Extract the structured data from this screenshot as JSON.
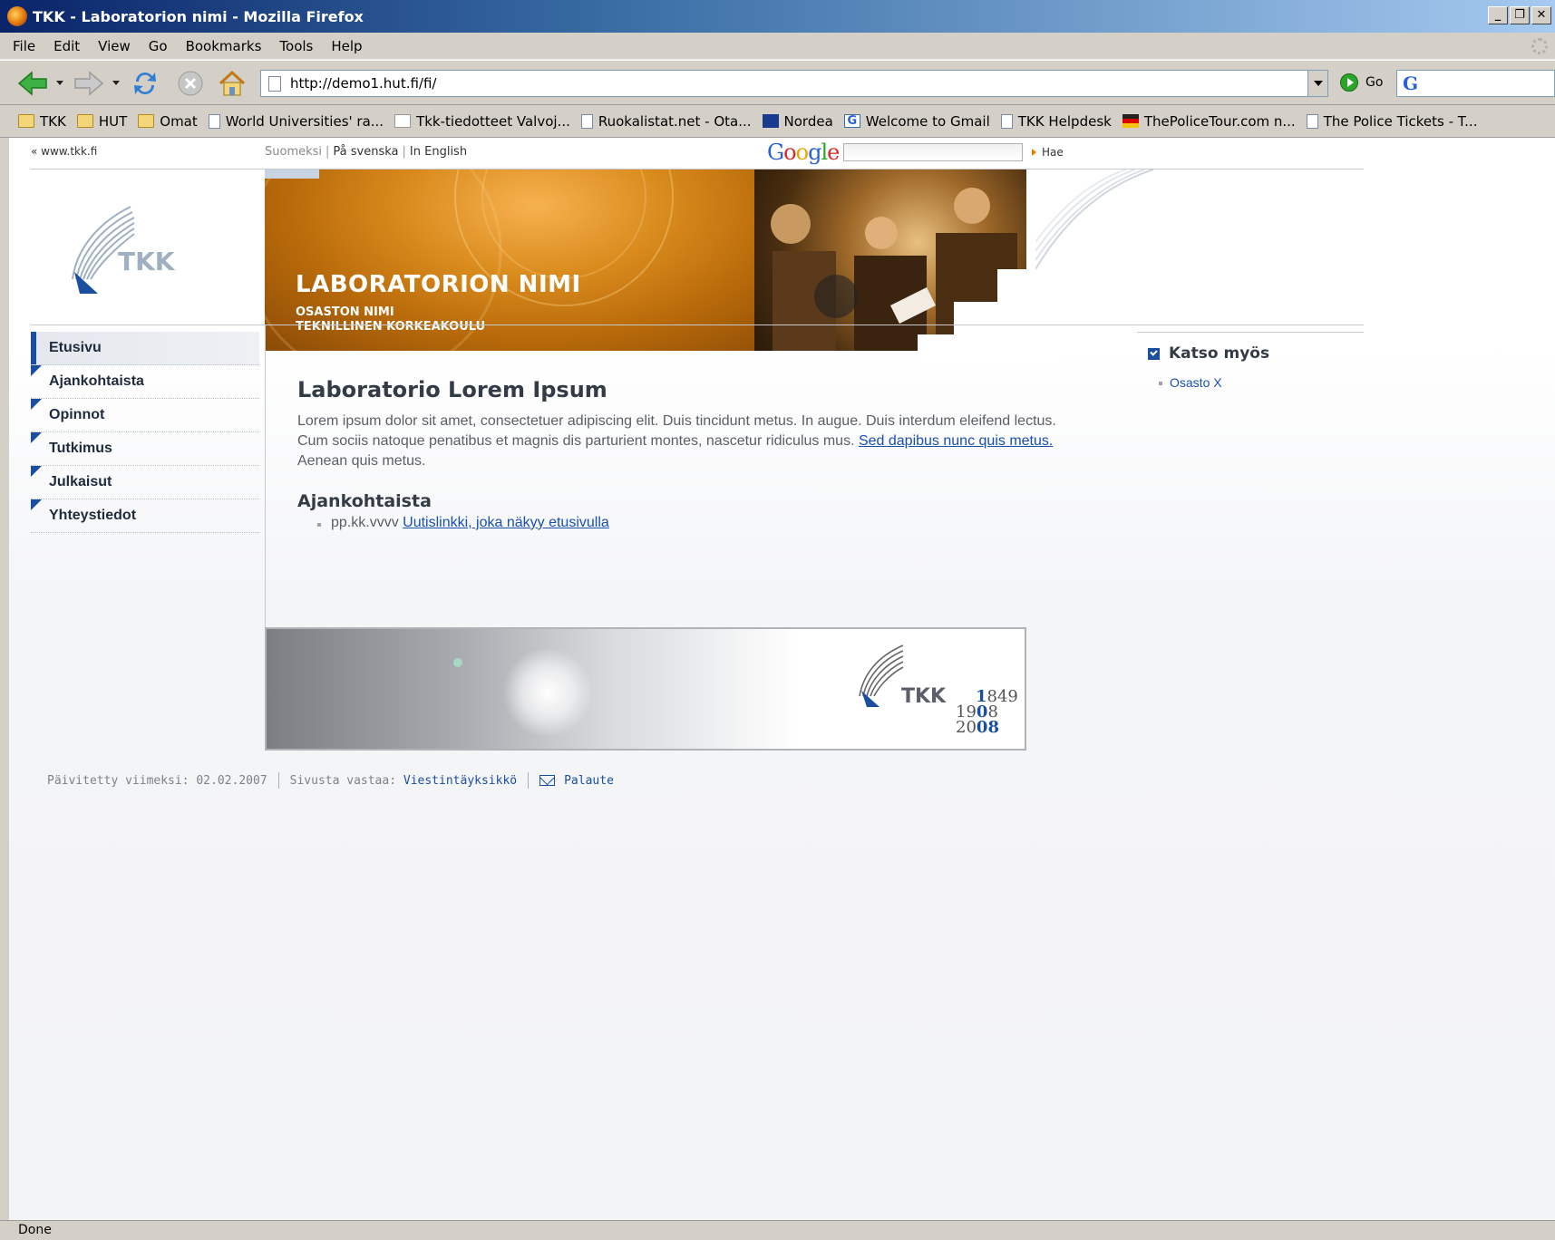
{
  "window": {
    "title": "TKK - Laboratorion nimi - Mozilla Firefox",
    "buttons": [
      "_",
      "❐",
      "✕"
    ]
  },
  "menubar": {
    "items": [
      "File",
      "Edit",
      "View",
      "Go",
      "Bookmarks",
      "Tools",
      "Help"
    ]
  },
  "navbar": {
    "url": "http://demo1.hut.fi/fi/",
    "go_label": "Go",
    "search_engine_icon": "google-icon"
  },
  "bookmarks": [
    {
      "label": "TKK",
      "icon": "folder-icon"
    },
    {
      "label": "HUT",
      "icon": "folder-icon"
    },
    {
      "label": "Omat",
      "icon": "folder-icon"
    },
    {
      "label": "World Universities' ra...",
      "icon": "page-icon"
    },
    {
      "label": "Tkk-tiedotteet Valvoj...",
      "icon": "mailman-icon"
    },
    {
      "label": "Ruokalistat.net - Ota...",
      "icon": "page-icon"
    },
    {
      "label": "Nordea",
      "icon": "nordea-icon"
    },
    {
      "label": "Welcome to Gmail",
      "icon": "gmail-icon"
    },
    {
      "label": "TKK Helpdesk",
      "icon": "page-icon"
    },
    {
      "label": "ThePoliceTour.com n...",
      "icon": "police-icon"
    },
    {
      "label": "The Police Tickets - T...",
      "icon": "page-icon"
    }
  ],
  "page": {
    "tkk_link": "« www.tkk.fi",
    "languages": {
      "finnish": "Suomeksi",
      "swedish": "På svenska",
      "english": "In English"
    },
    "search": {
      "logo": "Google",
      "button": "Hae"
    },
    "logo_text": "TKK",
    "banner": {
      "title": "LABORATORION NIMI",
      "line1": "OSASTON NIMI",
      "line2": "TEKNILLINEN KORKEAKOULU"
    },
    "nav": [
      {
        "label": "Etusivu",
        "active": true
      },
      {
        "label": "Ajankohtaista",
        "active": false
      },
      {
        "label": "Opinnot",
        "active": false
      },
      {
        "label": "Tutkimus",
        "active": false
      },
      {
        "label": "Julkaisut",
        "active": false
      },
      {
        "label": "Yhteystiedot",
        "active": false
      }
    ],
    "main": {
      "heading": "Laboratorio Lorem Ipsum",
      "body_text": "Lorem ipsum dolor sit amet, consectetuer adipiscing elit. Duis tincidunt metus. In augue. Duis interdum eleifend lectus. Cum sociis natoque penatibus et magnis dis parturient montes, nascetur ridiculus mus. ",
      "body_link": "Sed dapibus nunc quis metus.",
      "body_tail": " Aenean quis metus.",
      "news_heading": "Ajankohtaista",
      "news_date": "pp.kk.vvvv",
      "news_link": "Uutislinkki, joka näkyy etusivulla"
    },
    "see_also": {
      "heading": "Katso myös",
      "link": "Osasto X"
    },
    "footer_image": {
      "logo_text": "TKK",
      "year1_a": "1",
      "year1_b": "849",
      "year2_a": "19",
      "year2_b": "0",
      "year2_c": "8",
      "year3_a": "20",
      "year3_b": "0",
      "year3_c": "8"
    },
    "footer": {
      "updated_label": "Päivitetty viimeksi: 02.02.2007",
      "responsible_label": "Sivusta vastaa:",
      "responsible_link": "Viestintäyksikkö",
      "feedback_link": "Palaute"
    }
  },
  "statusbar": {
    "text": "Done"
  },
  "colors": {
    "accent_blue": "#1a4fa0",
    "banner_orange": "#d98a1c",
    "link": "#1a4fb0"
  }
}
